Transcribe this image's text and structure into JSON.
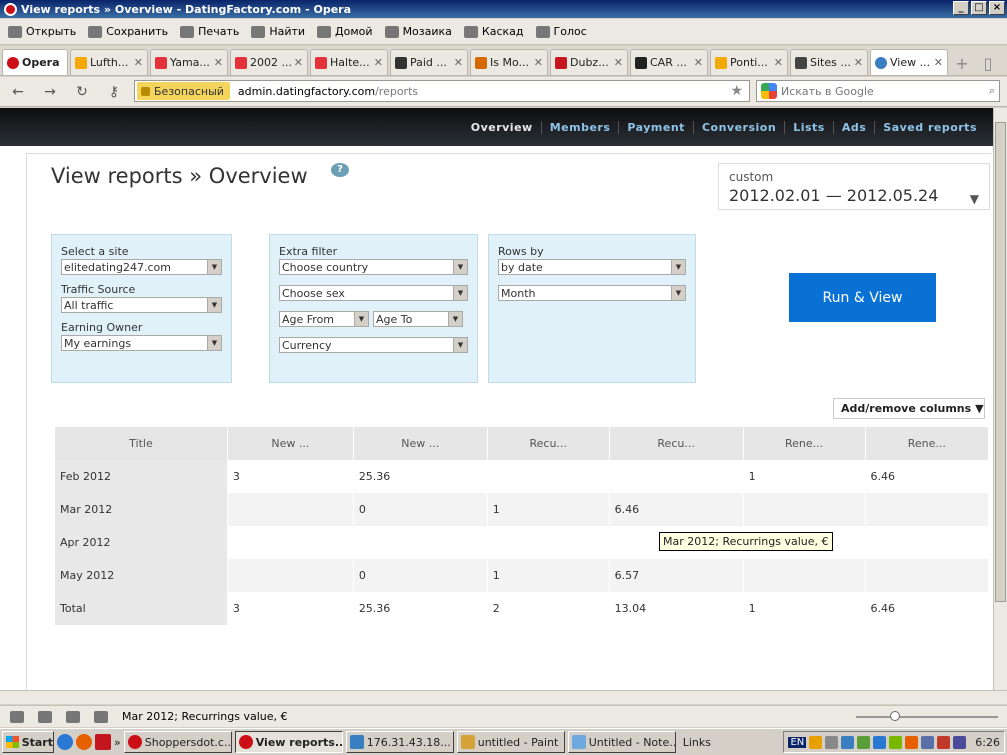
{
  "window": {
    "title": "View reports » Overview - DatingFactory.com - Opera"
  },
  "menubar": {
    "items": [
      "Открыть",
      "Сохранить",
      "Печать",
      "Найти",
      "Домой",
      "Мозаика",
      "Каскад",
      "Голос"
    ]
  },
  "tabs": [
    {
      "label": "Opera",
      "color": "#cc0f16"
    },
    {
      "label": "Lufth...",
      "color": "#f6a800"
    },
    {
      "label": "Yama...",
      "color": "#e53238"
    },
    {
      "label": "2002 ...",
      "color": "#e53238"
    },
    {
      "label": "Halte...",
      "color": "#e53238"
    },
    {
      "label": "Paid ...",
      "color": "#333333"
    },
    {
      "label": "Is Mo...",
      "color": "#d66a00"
    },
    {
      "label": "Dubz...",
      "color": "#c4161c"
    },
    {
      "label": "CAR ...",
      "color": "#222222"
    },
    {
      "label": "Ponti...",
      "color": "#f2a900"
    },
    {
      "label": "Sites ...",
      "color": "#444444"
    },
    {
      "label": "View ...",
      "color": "#3a7ec2"
    }
  ],
  "addressbar": {
    "secure_label": "Безопасный",
    "url_host": "admin.datingfactory.com",
    "url_path": "/reports",
    "search_placeholder": "Искать в Google"
  },
  "sitenav": [
    "Overview",
    "Members",
    "Payment",
    "Conversion",
    "Lists",
    "Ads",
    "Saved reports"
  ],
  "page": {
    "title": "View reports » Overview",
    "help": "?",
    "date_preset": "custom",
    "date_range": "2012.02.01 — 2012.05.24"
  },
  "filters": {
    "site_label": "Select a site",
    "site_value": "elitedating247.com",
    "traffic_label": "Traffic Source",
    "traffic_value": "All traffic",
    "owner_label": "Earning Owner",
    "owner_value": "My earnings",
    "extra_label": "Extra filter",
    "country": "Choose country",
    "sex": "Choose sex",
    "age_from": "Age From",
    "age_to": "Age To",
    "currency": "Currency",
    "rows_label": "Rows by",
    "rows_value": "by date",
    "period": "Month"
  },
  "run_button": "Run & View",
  "addcol_button": "Add/remove columns",
  "table": {
    "headers": [
      "Title",
      "New ...",
      "New ...",
      "Recu...",
      "Recu...",
      "Rene...",
      "Rene..."
    ],
    "rows": [
      [
        "Feb 2012",
        "3",
        "25.36",
        "",
        "",
        "1",
        "6.46"
      ],
      [
        "Mar 2012",
        "",
        "0",
        "1",
        "6.46",
        "",
        ""
      ],
      [
        "Apr 2012",
        "",
        "",
        "",
        "",
        "",
        ""
      ],
      [
        "May 2012",
        "",
        "0",
        "1",
        "6.57",
        "",
        ""
      ],
      [
        "Total",
        "3",
        "25.36",
        "2",
        "13.04",
        "1",
        "6.46"
      ]
    ]
  },
  "tooltip": "Mar 2012; Recurrings value, €",
  "statusbar": {
    "text": "Mar 2012; Recurrings value, €"
  },
  "taskbar": {
    "start": "Start",
    "tasks": [
      {
        "label": "Shoppersdot.c...",
        "color": "#cc0f16"
      },
      {
        "label": "View reports...",
        "color": "#cc0f16"
      },
      {
        "label": "176.31.43.18...",
        "color": "#3a7ec2"
      },
      {
        "label": "untitled - Paint",
        "color": "#d6a23a"
      },
      {
        "label": "Untitled - Note...",
        "color": "#6fa8dc"
      }
    ],
    "links": "Links",
    "lang": "EN",
    "clock": "6:26"
  }
}
